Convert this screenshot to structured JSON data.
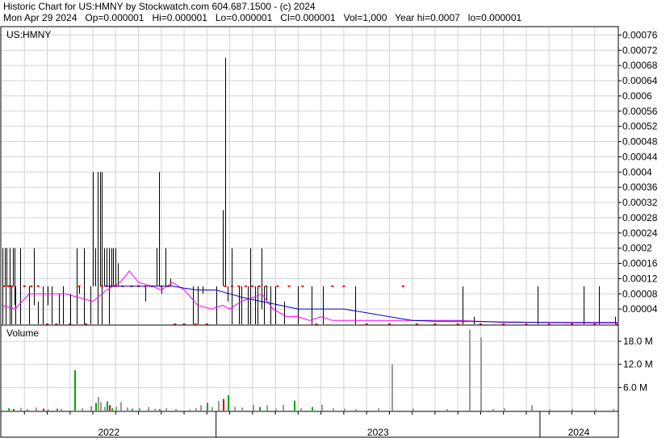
{
  "header": {
    "line1": "Historic Chart for US:HMNY by Stockwatch.com 604.687.1500 - (c) 2024",
    "line2": "Mon Apr 29 2024   Op=0.000001   Hi=0.000001   Lo=0.000001   Cl=0.000001   Vol=1,000   Year hi=0.0007   lo=0.000001"
  },
  "colors": {
    "price_bar": "#000000",
    "close_marker": "#ff0000",
    "ma_short": "#ff00ff",
    "ma_long": "#0000cc",
    "volume_up": "#00aa00",
    "volume_down": "#cc0000",
    "volume_flat": "#999999",
    "grid": "#d3d3d3"
  },
  "chart_data": [
    {
      "type": "line",
      "title": "US:HMNY",
      "y_tick_labels": [
        "0.00076",
        "0.00072",
        "0.00068",
        "0.00064",
        "0.0006",
        "0.00056",
        "0.00052",
        "0.00048",
        "0.00044",
        "0.0004",
        "0.00036",
        "0.00032",
        "0.00028",
        "0.00024",
        "0.0002",
        "0.00016",
        "0.00012",
        "0.00008",
        "0.00004"
      ],
      "ylim": [
        0,
        0.00078
      ],
      "x_labels": [
        "2022",
        "2023",
        "2024"
      ],
      "price_ranges": [
        [
          0.05,
          0.0,
          0.0002
        ],
        [
          0.15,
          0.0001,
          0.0002
        ],
        [
          0.18,
          0.0,
          0.0001
        ],
        [
          0.22,
          0.0001,
          0.0002
        ],
        [
          0.35,
          0.0,
          0.0002
        ],
        [
          0.42,
          0.0,
          0.0001
        ],
        [
          0.5,
          0.0001,
          0.0002
        ],
        [
          0.55,
          5e-05,
          0.0002
        ],
        [
          0.6,
          0.0,
          0.0001
        ],
        [
          0.8,
          0.0,
          0.0002
        ],
        [
          1.0,
          5e-05,
          5e-05
        ],
        [
          1.2,
          0.0,
          0.0001
        ],
        [
          1.4,
          5e-05,
          0.0002
        ],
        [
          1.6,
          0.0,
          6e-05
        ],
        [
          1.8,
          0.0,
          0.0001
        ],
        [
          2.0,
          5e-05,
          0.0001
        ],
        [
          2.2,
          0.0,
          0.0001
        ],
        [
          2.5,
          0.0,
          8e-05
        ],
        [
          2.7,
          0.0,
          0.0001
        ],
        [
          3.0,
          0.0,
          8e-05
        ],
        [
          3.3,
          0.0,
          0.0002
        ],
        [
          3.4,
          8e-05,
          0.0001
        ],
        [
          3.6,
          0.0,
          0.0002
        ],
        [
          3.9,
          0.0,
          0.0001
        ],
        [
          4.0,
          0.0001,
          0.0004
        ],
        [
          4.1,
          0.0001,
          0.0002
        ],
        [
          4.2,
          0.0,
          0.0004
        ],
        [
          4.3,
          0.0001,
          0.0004
        ],
        [
          4.4,
          0.0,
          0.0004
        ],
        [
          4.5,
          0.0001,
          0.0002
        ],
        [
          4.6,
          0.0001,
          0.0002
        ],
        [
          4.7,
          0.0,
          0.0002
        ],
        [
          4.8,
          0.0001,
          0.0002
        ],
        [
          4.9,
          0.0001,
          0.0002
        ],
        [
          5.0,
          0.0001,
          0.0002
        ],
        [
          5.1,
          0.0001,
          0.00016
        ],
        [
          5.3,
          0.0001,
          0.0001
        ],
        [
          5.6,
          0.0001,
          0.0001
        ],
        [
          6.0,
          0.0001,
          0.0001
        ],
        [
          6.3,
          6e-05,
          0.0001
        ],
        [
          6.5,
          0.0001,
          0.0001
        ],
        [
          6.8,
          0.0001,
          0.0002
        ],
        [
          6.9,
          0.0001,
          0.0004
        ],
        [
          7.0,
          8e-05,
          0.0001
        ],
        [
          7.2,
          0.0001,
          0.0002
        ],
        [
          7.4,
          0.0001,
          0.00012
        ],
        [
          7.8,
          0.0001,
          0.0001
        ],
        [
          8.4,
          0.0,
          0.0001
        ],
        [
          8.6,
          0.0,
          0.0001
        ],
        [
          8.8,
          8e-05,
          0.0001
        ],
        [
          9.4,
          0.0,
          0.0001
        ],
        [
          9.7,
          0.0001,
          0.0003
        ],
        [
          9.8,
          0.0001,
          0.0007
        ],
        [
          9.9,
          6e-05,
          0.0001
        ],
        [
          10.1,
          0.0,
          0.0002
        ],
        [
          10.4,
          0.0,
          0.0001
        ],
        [
          10.5,
          0.0,
          0.0001
        ],
        [
          10.8,
          0.0,
          0.0001
        ],
        [
          10.9,
          0.0,
          0.0002
        ],
        [
          11.1,
          0.0,
          0.0001
        ],
        [
          11.2,
          0.0,
          0.0001
        ],
        [
          11.4,
          4e-05,
          0.0002
        ],
        [
          11.5,
          0.0,
          0.0001
        ],
        [
          11.6,
          6e-05,
          0.0001
        ],
        [
          11.8,
          0.0,
          0.0001
        ],
        [
          12.0,
          0.0,
          0.0001
        ],
        [
          12.4,
          0.0,
          6e-05
        ],
        [
          13.0,
          0.0,
          0.0001
        ],
        [
          13.6,
          0.0,
          0.0001
        ],
        [
          14.1,
          0.0,
          0.0001
        ],
        [
          15.5,
          0.0,
          0.0001
        ],
        [
          20.2,
          0.0,
          0.0001
        ],
        [
          20.7,
          0.0,
          2e-05
        ],
        [
          23.5,
          0.0,
          0.0001
        ],
        [
          25.5,
          0.0,
          0.0001
        ],
        [
          26.2,
          0.0,
          0.0001
        ],
        [
          26.9,
          0.0,
          2e-05
        ]
      ],
      "closes": [
        [
          0.1,
          0.0001
        ],
        [
          0.3,
          0.0001
        ],
        [
          0.45,
          0.0001
        ],
        [
          1.0,
          0.0001
        ],
        [
          1.3,
          0.0001
        ],
        [
          1.6,
          0.0001
        ],
        [
          2.0,
          0.0
        ],
        [
          2.4,
          0.0
        ],
        [
          3.0,
          0.0
        ],
        [
          3.4,
          0.0001
        ],
        [
          3.7,
          0.0
        ],
        [
          4.4,
          0.0001
        ],
        [
          4.6,
          0.0001
        ],
        [
          4.8,
          0.0001
        ],
        [
          5.0,
          0.0001
        ],
        [
          5.3,
          0.0001
        ],
        [
          5.7,
          0.0001
        ],
        [
          6.0,
          0.0001
        ],
        [
          6.3,
          0.0001
        ],
        [
          6.6,
          0.0001
        ],
        [
          7.0,
          0.0001
        ],
        [
          7.3,
          0.0001
        ],
        [
          7.6,
          0.0
        ],
        [
          8.0,
          0.0
        ],
        [
          8.5,
          0.0
        ],
        [
          9.0,
          0.0
        ],
        [
          9.8,
          0.0001
        ],
        [
          10.1,
          0.0001
        ],
        [
          10.4,
          0.0001
        ],
        [
          10.7,
          0.0001
        ],
        [
          11.0,
          0.0001
        ],
        [
          11.3,
          0.0001
        ],
        [
          11.6,
          0.0001
        ],
        [
          12.1,
          0.0001
        ],
        [
          12.6,
          0.0001
        ],
        [
          13.2,
          0.0001
        ],
        [
          13.8,
          0.0
        ],
        [
          14.5,
          0.0001
        ],
        [
          15.0,
          0.0001
        ],
        [
          16.0,
          0.0
        ],
        [
          17.0,
          0.0
        ],
        [
          17.6,
          0.0001
        ],
        [
          18.2,
          0.0
        ],
        [
          19.0,
          0.0
        ],
        [
          20.0,
          0.0
        ],
        [
          21.0,
          0.0
        ],
        [
          22.0,
          0.0
        ],
        [
          23.0,
          0.0
        ],
        [
          24.0,
          0.0
        ],
        [
          25.0,
          0.0
        ],
        [
          26.0,
          0.0
        ],
        [
          27.0,
          0.0
        ]
      ],
      "series": [
        {
          "values": [
            [
              0.0,
              5e-05
            ],
            [
              0.6,
              4e-05
            ],
            [
              1.2,
              8e-05
            ],
            [
              2.0,
              8e-05
            ],
            [
              2.8,
              8e-05
            ],
            [
              3.4,
              7e-05
            ],
            [
              4.0,
              6e-05
            ],
            [
              4.6,
              9e-05
            ],
            [
              5.2,
              0.00011
            ],
            [
              5.6,
              0.00014
            ],
            [
              6.0,
              0.00011
            ],
            [
              6.6,
              0.0001
            ],
            [
              7.0,
              9e-05
            ],
            [
              7.5,
              0.00011
            ],
            [
              8.0,
              9e-05
            ],
            [
              8.6,
              5e-05
            ],
            [
              9.2,
              4e-05
            ],
            [
              9.7,
              5e-05
            ],
            [
              10.0,
              4e-05
            ],
            [
              10.5,
              6e-05
            ],
            [
              11.0,
              7e-05
            ],
            [
              11.4,
              8e-05
            ],
            [
              11.9,
              4e-05
            ],
            [
              12.5,
              2e-05
            ],
            [
              13.0,
              2e-05
            ],
            [
              13.5,
              1e-05
            ],
            [
              14.0,
              2e-05
            ],
            [
              14.5,
              1e-05
            ],
            [
              15.5,
              1e-05
            ],
            [
              16.5,
              1e-05
            ],
            [
              17.5,
              1e-05
            ],
            [
              18.5,
              1e-05
            ],
            [
              20.0,
              1e-05
            ],
            [
              22.0,
              5e-06
            ],
            [
              24.0,
              5e-06
            ],
            [
              26.0,
              5e-06
            ],
            [
              27.0,
              5e-06
            ]
          ]
        },
        {
          "values": [
            [
              4.5,
              0.0001
            ],
            [
              5.5,
              0.0001
            ],
            [
              6.5,
              0.0001
            ],
            [
              7.5,
              0.0001
            ],
            [
              8.0,
              9.5e-05
            ],
            [
              8.6,
              9e-05
            ],
            [
              9.4,
              9e-05
            ],
            [
              10.0,
              8e-05
            ],
            [
              10.6,
              7e-05
            ],
            [
              11.4,
              6e-05
            ],
            [
              12.2,
              5e-05
            ],
            [
              13.0,
              4e-05
            ],
            [
              14.0,
              4e-05
            ],
            [
              15.0,
              4e-05
            ],
            [
              16.0,
              3e-05
            ],
            [
              17.0,
              2e-05
            ],
            [
              18.0,
              1e-05
            ],
            [
              19.0,
              8e-06
            ],
            [
              20.5,
              8e-06
            ],
            [
              22.0,
              6e-06
            ],
            [
              23.5,
              5e-06
            ],
            [
              25.0,
              4e-06
            ],
            [
              27.0,
              4e-06
            ]
          ]
        }
      ]
    },
    {
      "type": "bar",
      "title": "Volume",
      "y_tick_labels": [
        "18.0 M",
        "12.0 M",
        "6.0 M"
      ],
      "y_tick_values": [
        18,
        12,
        6
      ],
      "ylim": [
        0,
        22
      ],
      "bars": [
        [
          0.3,
          0.6,
          "up"
        ],
        [
          0.5,
          0.4,
          "down"
        ],
        [
          0.8,
          0.7,
          "flat"
        ],
        [
          1.1,
          0.3,
          "up"
        ],
        [
          1.5,
          0.8,
          "flat"
        ],
        [
          1.8,
          0.5,
          "down"
        ],
        [
          2.0,
          0.3,
          "flat"
        ],
        [
          2.4,
          0.5,
          "up"
        ],
        [
          2.6,
          0.4,
          "flat"
        ],
        [
          3.2,
          10.5,
          "up"
        ],
        [
          3.5,
          0.6,
          "flat"
        ],
        [
          3.9,
          1.2,
          "flat"
        ],
        [
          4.1,
          2.0,
          "up"
        ],
        [
          4.2,
          3.5,
          "flat"
        ],
        [
          4.3,
          2.2,
          "flat"
        ],
        [
          4.5,
          1.0,
          "flat"
        ],
        [
          4.6,
          2.4,
          "up"
        ],
        [
          4.7,
          1.4,
          "down"
        ],
        [
          4.8,
          0.6,
          "up"
        ],
        [
          5.0,
          1.0,
          "flat"
        ],
        [
          5.2,
          2.2,
          "flat"
        ],
        [
          5.5,
          0.8,
          "flat"
        ],
        [
          5.7,
          0.5,
          "up"
        ],
        [
          6.0,
          0.7,
          "flat"
        ],
        [
          6.4,
          0.9,
          "flat"
        ],
        [
          6.7,
          0.5,
          "flat"
        ],
        [
          6.9,
          0.4,
          "up"
        ],
        [
          7.2,
          0.6,
          "flat"
        ],
        [
          7.6,
          0.4,
          "flat"
        ],
        [
          8.2,
          0.3,
          "flat"
        ],
        [
          8.5,
          0.6,
          "flat"
        ],
        [
          8.7,
          1.4,
          "flat"
        ],
        [
          9.0,
          2.0,
          "up"
        ],
        [
          9.2,
          0.9,
          "flat"
        ],
        [
          9.5,
          2.5,
          "flat"
        ],
        [
          9.7,
          3.0,
          "down"
        ],
        [
          9.9,
          4.0,
          "up"
        ],
        [
          10.2,
          1.0,
          "flat"
        ],
        [
          10.5,
          0.8,
          "flat"
        ],
        [
          11.0,
          1.5,
          "flat"
        ],
        [
          11.3,
          0.9,
          "up"
        ],
        [
          11.6,
          1.4,
          "flat"
        ],
        [
          12.0,
          0.5,
          "flat"
        ],
        [
          12.3,
          1.5,
          "flat"
        ],
        [
          12.8,
          2.6,
          "up"
        ],
        [
          13.1,
          0.6,
          "flat"
        ],
        [
          13.6,
          0.9,
          "up"
        ],
        [
          14.0,
          1.5,
          "flat"
        ],
        [
          14.5,
          0.6,
          "flat"
        ],
        [
          15.0,
          0.5,
          "flat"
        ],
        [
          15.5,
          0.4,
          "flat"
        ],
        [
          16.5,
          0.6,
          "flat"
        ],
        [
          17.1,
          12.0,
          "flat"
        ],
        [
          18.0,
          0.5,
          "flat"
        ],
        [
          19.5,
          0.4,
          "flat"
        ],
        [
          20.5,
          21.0,
          "flat"
        ],
        [
          21.0,
          19.0,
          "flat"
        ],
        [
          21.5,
          0.4,
          "flat"
        ],
        [
          22.0,
          0.6,
          "flat"
        ],
        [
          23.2,
          1.4,
          "flat"
        ],
        [
          24.0,
          0.3,
          "flat"
        ],
        [
          25.0,
          0.4,
          "flat"
        ],
        [
          26.0,
          0.3,
          "flat"
        ],
        [
          26.8,
          0.4,
          "flat"
        ]
      ]
    }
  ],
  "price_panel": {
    "title": "US:HMNY"
  },
  "volume_panel": {
    "title": "Volume"
  }
}
